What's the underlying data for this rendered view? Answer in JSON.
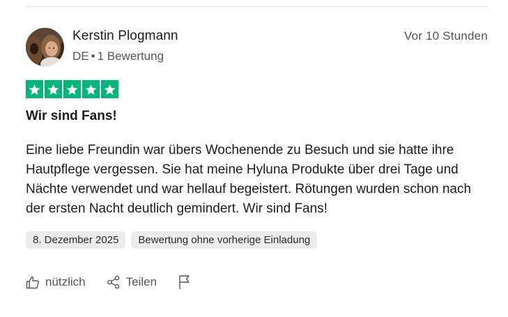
{
  "review": {
    "author": "Kerstin Plogmann",
    "country": "DE",
    "separator": "•",
    "review_count": "1 Bewertung",
    "relative_time": "Vor 10 Stunden",
    "rating": 5,
    "title": "Wir sind Fans!",
    "body": "Eine liebe Freundin war übers Wochenende zu Besuch und sie hatte ihre Hautpflege vergessen. Sie hat meine Hyluna Produkte über drei Tage und Nächte verwendet und war hellauf begeistert. Rötungen wurden schon nach der ersten Nacht deutlich gemindert. Wir sind Fans!",
    "tags": [
      "8. Dezember 2025",
      "Bewertung ohne vorherige Einladung"
    ]
  },
  "actions": {
    "useful_label": "nützlich",
    "share_label": "Teilen",
    "useful_icon": "thumbs-up-icon",
    "share_icon": "share-icon",
    "flag_icon": "flag-icon"
  },
  "colors": {
    "star_bg": "#00b67a",
    "tag_bg": "#ececec",
    "muted_text": "#555555"
  }
}
